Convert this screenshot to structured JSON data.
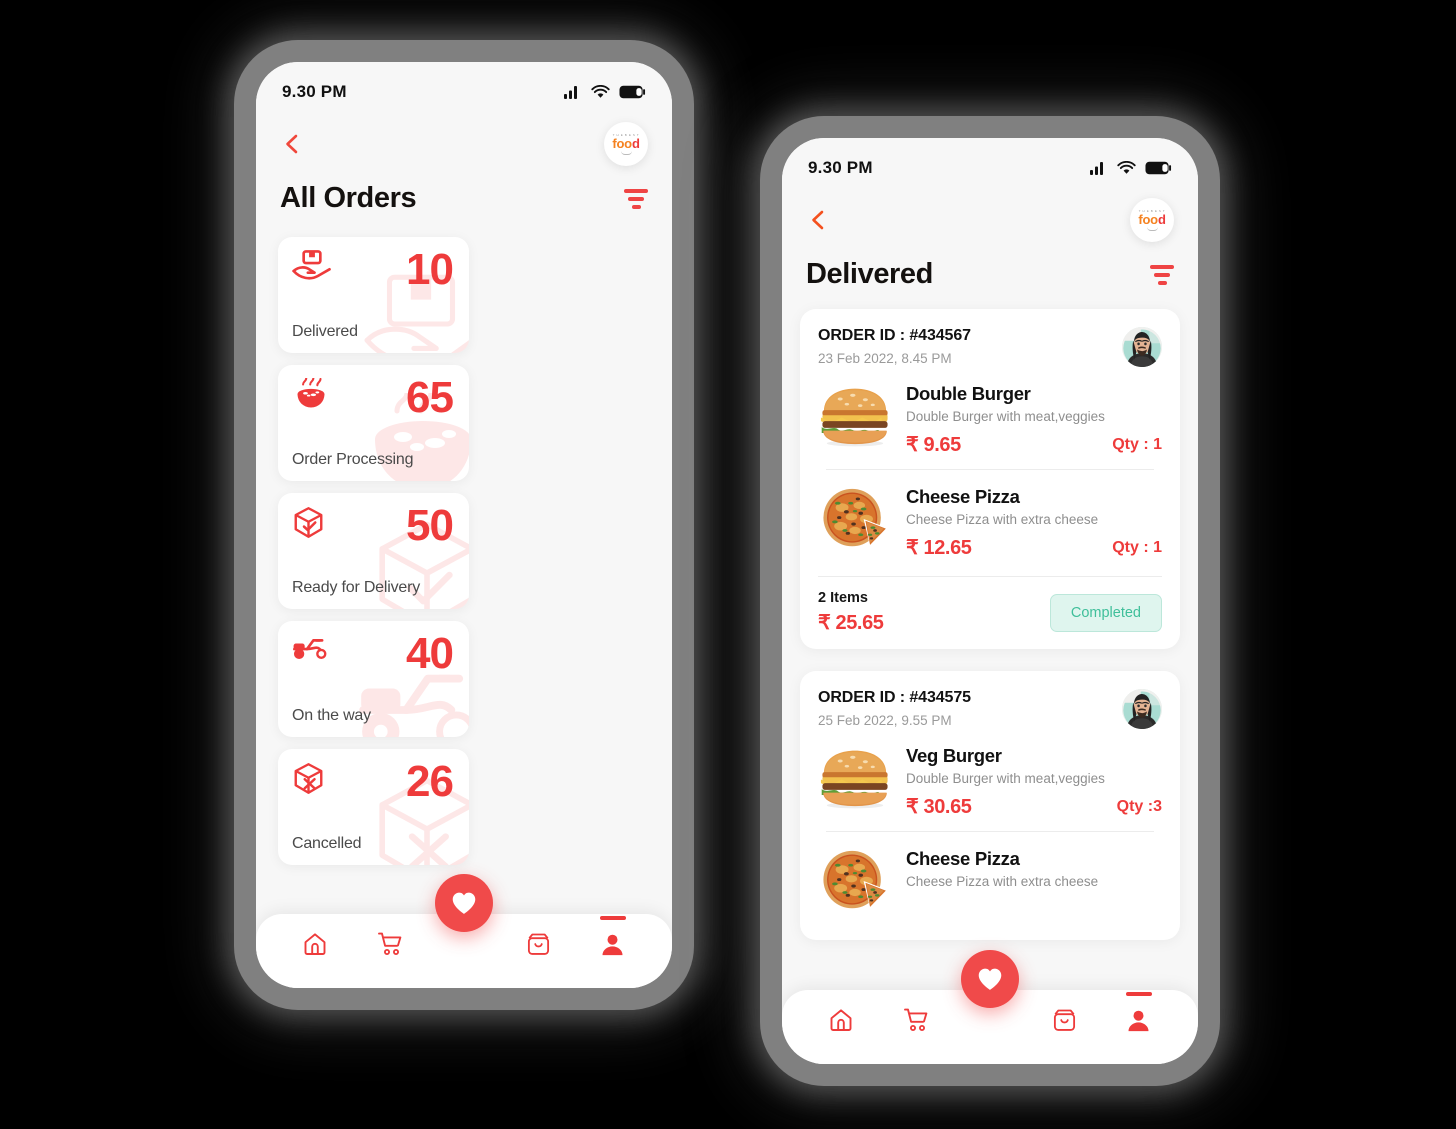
{
  "accent": {
    "red": "#EE3B3B",
    "red_soft": "#F04A4A",
    "orange": "#F58220",
    "mint_bg": "#DFF5EE",
    "mint_text": "#3FBF9A",
    "page_bg": "#F7F7F7",
    "canvas_bg": "#000000",
    "frame_gray": "#808080"
  },
  "left_phone": {
    "status": {
      "time": "9.30 PM",
      "signal_icon": "signal-bars-icon",
      "wifi_icon": "wifi-icon",
      "battery_icon": "battery-icon"
    },
    "nav": {
      "back_icon": "chevron-left-icon",
      "logo_text_top": "T H E  B E S T",
      "logo_text": "food",
      "logo_icon": "food-logo-icon"
    },
    "title": "All Orders",
    "filter_icon": "filter-icon",
    "stats": [
      {
        "value": "10",
        "label": "Delivered",
        "icon": "hand-package-icon"
      },
      {
        "value": "65",
        "label": "Order Processing",
        "icon": "cooking-bowl-icon"
      },
      {
        "value": "50",
        "label": "Ready for Delivery",
        "icon": "box-check-icon"
      },
      {
        "value": "40",
        "label": "On the way",
        "icon": "scooter-icon"
      },
      {
        "value": "26",
        "label": "Cancelled",
        "icon": "box-cancel-icon"
      }
    ],
    "tabs": [
      {
        "name": "home",
        "icon": "home-icon",
        "active": false
      },
      {
        "name": "cart",
        "icon": "cart-icon",
        "active": false
      },
      {
        "name": "bag",
        "icon": "shopping-bag-icon",
        "active": false
      },
      {
        "name": "profile",
        "icon": "person-icon",
        "active": true
      }
    ],
    "fab_icon": "heart-icon"
  },
  "right_phone": {
    "status": {
      "time": "9.30 PM",
      "signal_icon": "signal-bars-icon",
      "wifi_icon": "wifi-icon",
      "battery_icon": "battery-icon"
    },
    "nav": {
      "back_icon": "chevron-left-icon",
      "logo_text_top": "T H E  B E S T",
      "logo_text": "food",
      "logo_icon": "food-logo-icon"
    },
    "title": "Delivered",
    "filter_icon": "filter-icon",
    "orders": [
      {
        "id_label": "ORDER ID : #434567",
        "date": "23 Feb 2022, 8.45 PM",
        "avatar_icon": "user-avatar",
        "items": [
          {
            "name": "Double Burger",
            "desc": "Double Burger with meat,veggies",
            "price": "₹ 9.65",
            "qty": "Qty : 1",
            "image": "burger-image"
          },
          {
            "name": "Cheese Pizza",
            "desc": "Cheese Pizza with extra cheese",
            "price": "₹ 12.65",
            "qty": "Qty : 1",
            "image": "pizza-image"
          }
        ],
        "item_count": "2 Items",
        "total": "₹ 25.65",
        "status": "Completed"
      },
      {
        "id_label": "ORDER ID : #434575",
        "date": "25 Feb 2022, 9.55 PM",
        "avatar_icon": "user-avatar",
        "items": [
          {
            "name": "Veg Burger",
            "desc": "Double Burger with meat,veggies",
            "price": "₹ 30.65",
            "qty": "Qty :3",
            "image": "burger-image"
          },
          {
            "name": "Cheese Pizza",
            "desc": "Cheese Pizza with extra cheese",
            "price": "",
            "qty": "",
            "image": "pizza-image"
          }
        ]
      }
    ],
    "tabs": [
      {
        "name": "home",
        "icon": "home-icon",
        "active": false
      },
      {
        "name": "cart",
        "icon": "cart-icon",
        "active": false
      },
      {
        "name": "bag",
        "icon": "shopping-bag-icon",
        "active": false
      },
      {
        "name": "profile",
        "icon": "person-icon",
        "active": true
      }
    ],
    "fab_icon": "heart-icon"
  }
}
